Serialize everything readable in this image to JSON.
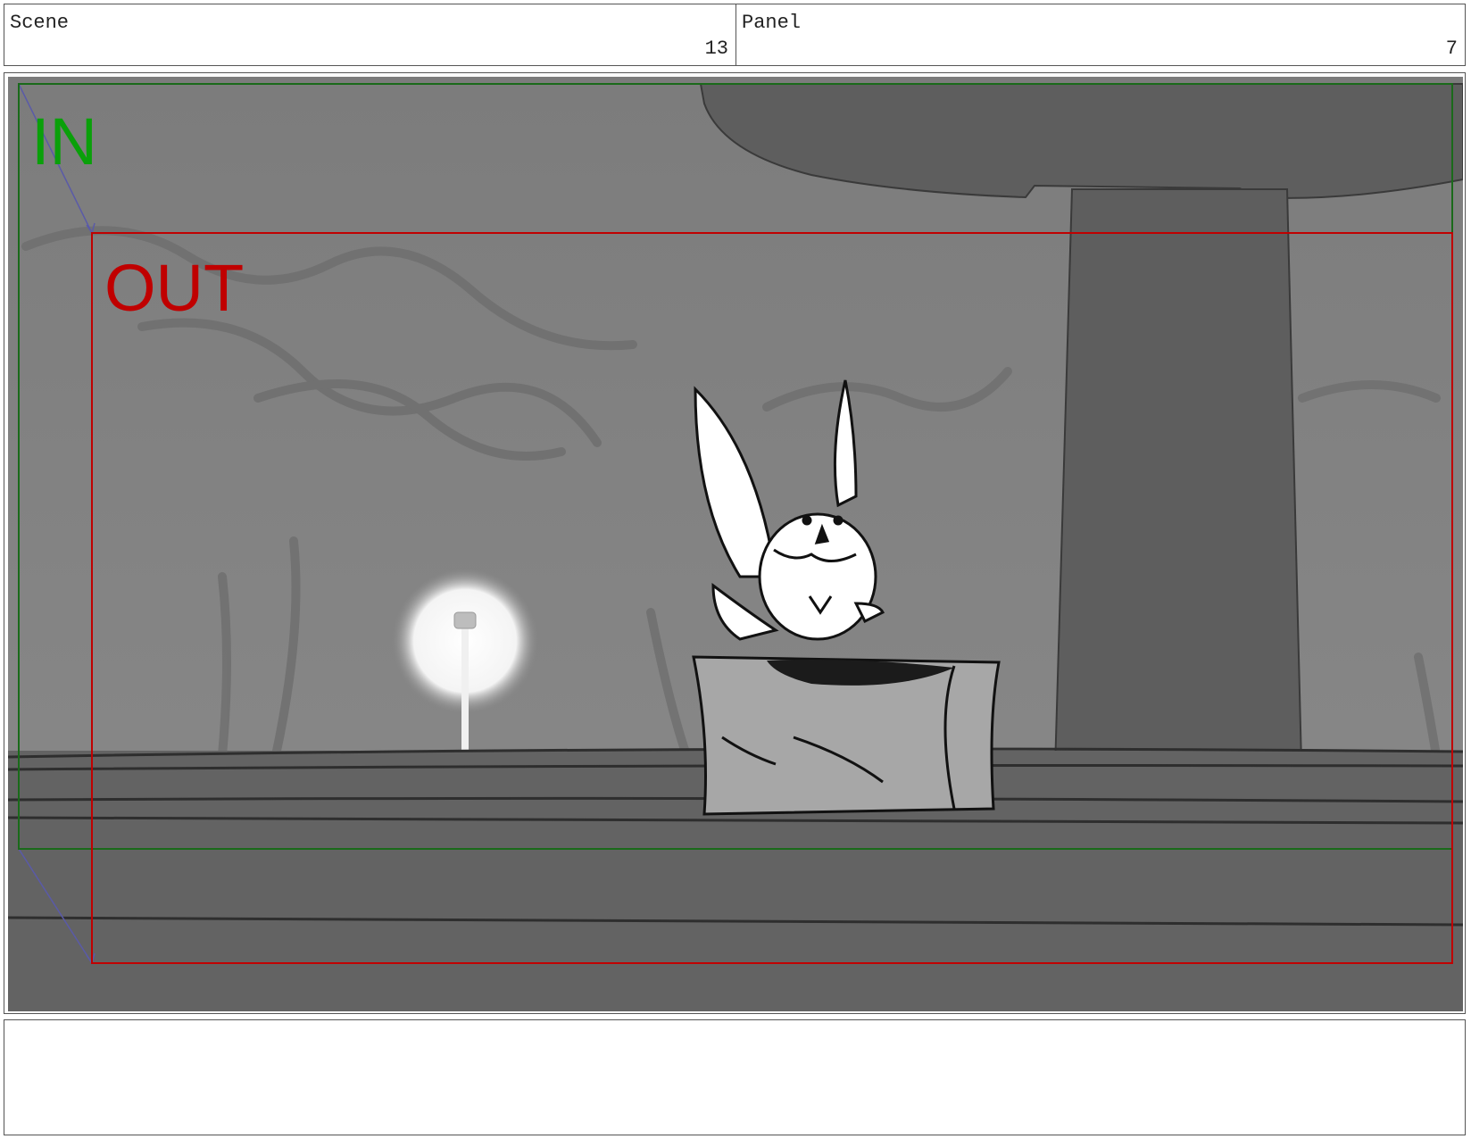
{
  "header": {
    "scene_label": "Scene",
    "scene_number": "13",
    "panel_label": "Panel",
    "panel_number": "7"
  },
  "camera": {
    "in_label": "IN",
    "out_label": "OUT",
    "in_color": "#0aa00a",
    "out_color": "#c00000",
    "move_arrow_color": "#5a5aa8"
  },
  "notes": {
    "text": ""
  }
}
